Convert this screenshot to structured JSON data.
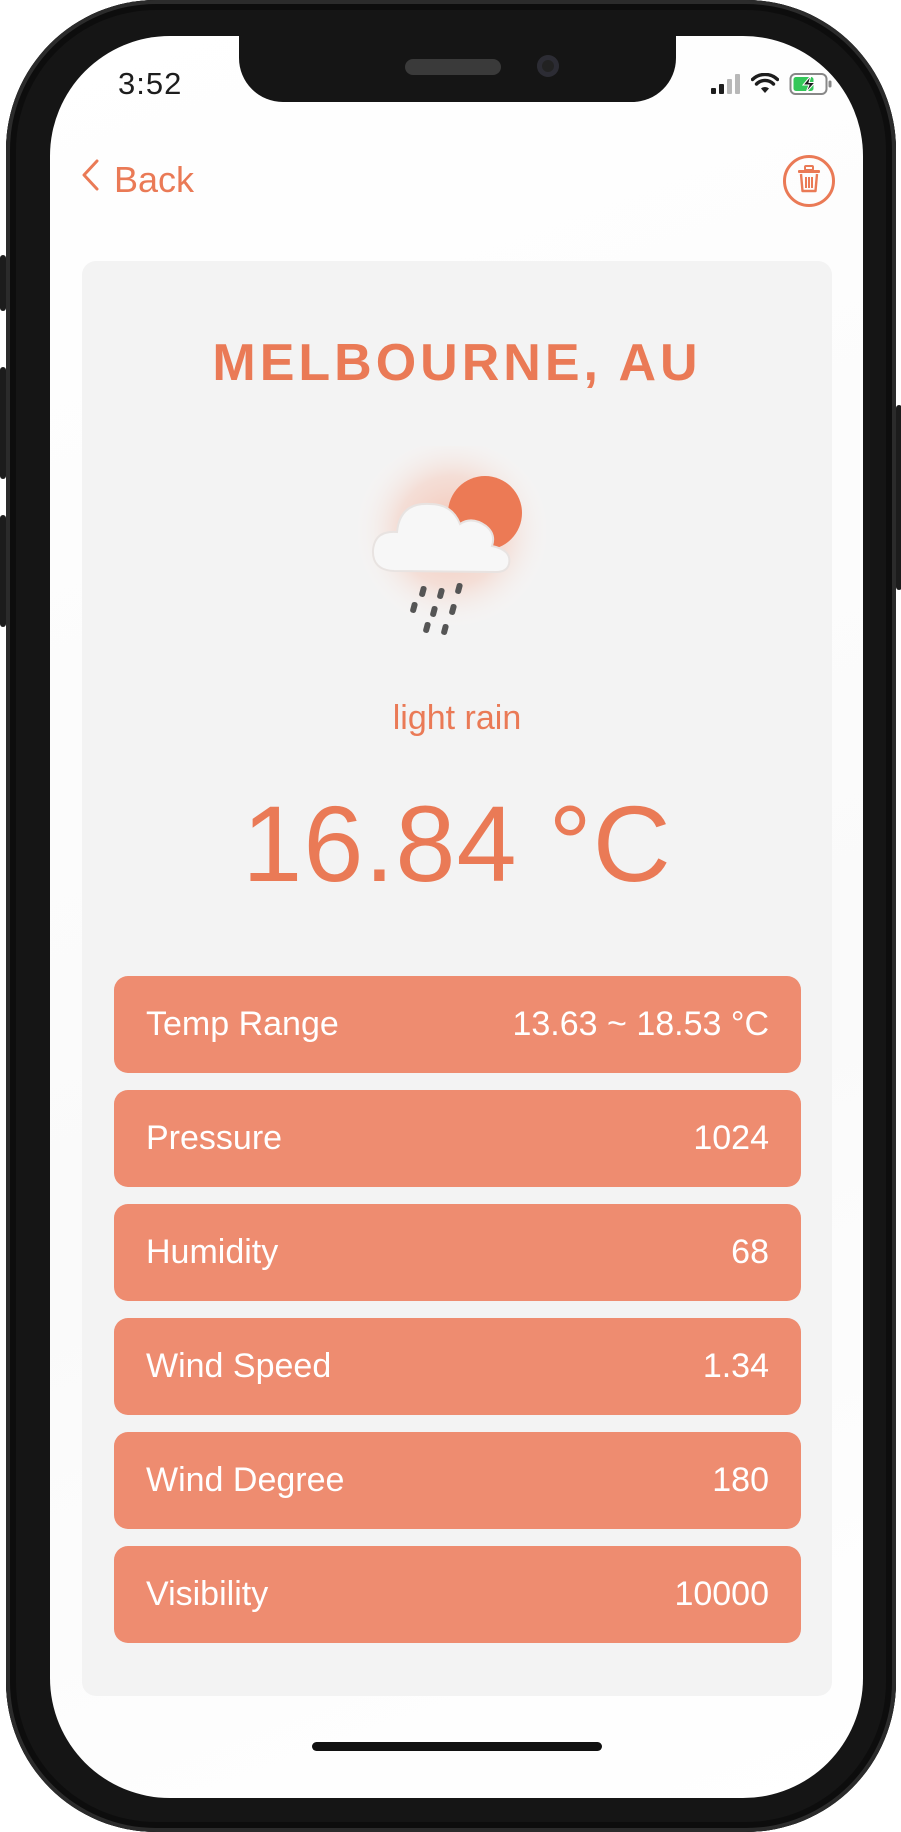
{
  "status_bar": {
    "time": "3:52"
  },
  "nav": {
    "back_label": "Back"
  },
  "weather": {
    "city": "MELBOURNE, AU",
    "description": "light rain",
    "temperature": "16.84 °C",
    "icon": "rain-cloud-sun-icon"
  },
  "stats": [
    {
      "label": "Temp Range",
      "value": "13.63 ~ 18.53 °C"
    },
    {
      "label": "Pressure",
      "value": "1024"
    },
    {
      "label": "Humidity",
      "value": "68"
    },
    {
      "label": "Wind Speed",
      "value": "1.34"
    },
    {
      "label": "Wind Degree",
      "value": "180"
    },
    {
      "label": "Visibility",
      "value": "10000"
    }
  ],
  "colors": {
    "accent": "#ea7a56",
    "row_background": "#ee8c70",
    "card_background": "#f3f3f3"
  }
}
